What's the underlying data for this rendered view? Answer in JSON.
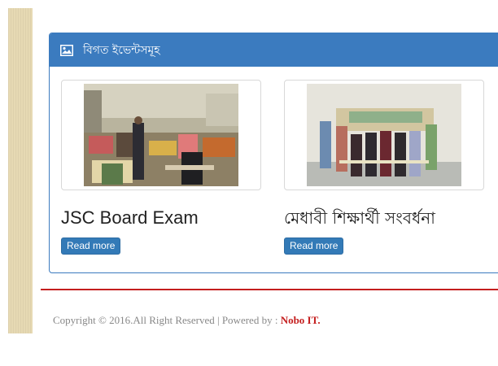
{
  "panel": {
    "title": "বিগত ইভেন্টসমূহ",
    "icon": "image-icon"
  },
  "events": [
    {
      "title": "JSC Board Exam",
      "button": "Read more",
      "image": "exam-hall-photo"
    },
    {
      "title": "মেধাবী শিক্ষার্থী সংবর্ধনা",
      "button": "Read more",
      "image": "student-reception-photo"
    }
  ],
  "footer": {
    "copyright": "Copyright © 2016.All Right Reserved | Powered by : ",
    "brand": "Nobo IT."
  },
  "colors": {
    "panel": "#3b7bbf",
    "button": "#337ab7",
    "divider": "#c41e1e",
    "brand": "#c41e1e"
  }
}
